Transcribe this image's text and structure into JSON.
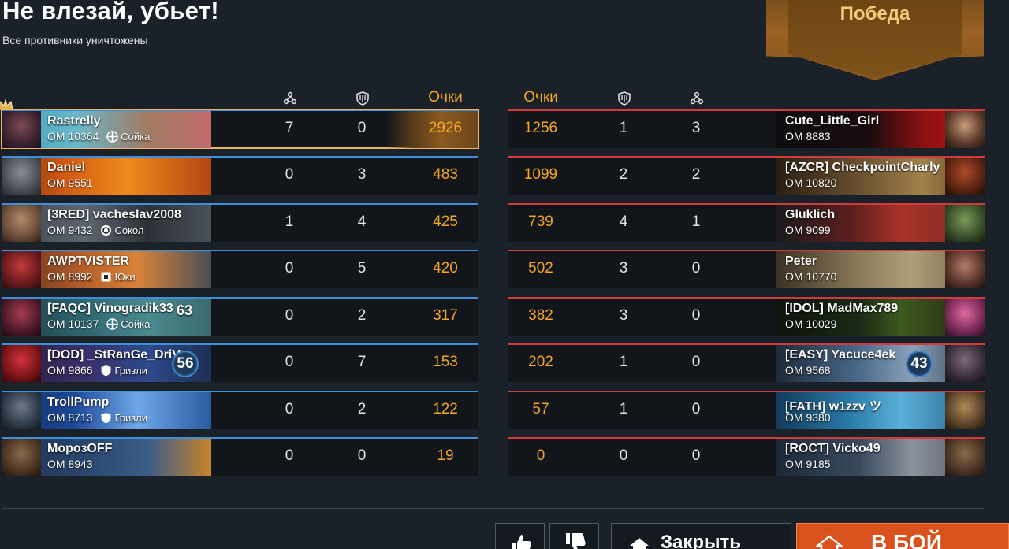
{
  "header": {
    "title": "Не влезай, убьет!",
    "subtitle": "Все противники уничтожены",
    "result": "Победа"
  },
  "columns": {
    "kills_icon": "kills-icon",
    "assists_icon": "shield-icon",
    "points_label_left": "Очки",
    "points_label_right": "Очки"
  },
  "colors": {
    "points": "#f4a623",
    "team_left_accent": "#3e8fd8",
    "team_right_accent": "#d23b3b",
    "mvp_frame": "#e6b56a",
    "battle_button": "#d9521d"
  },
  "team_left": [
    {
      "name": "Rastrelly",
      "rating": "ОМ 10364",
      "rank": "Сойка",
      "rank_icon": "cross-icon",
      "level": "",
      "kills": "7",
      "assists": "0",
      "points": "2926",
      "mvp": true
    },
    {
      "name": "Daniel",
      "rating": "ОМ 9551",
      "rank": "",
      "rank_icon": "",
      "level": "",
      "kills": "0",
      "assists": "3",
      "points": "483"
    },
    {
      "name": "[3RED] vacheslav2008",
      "rating": "ОМ 9432",
      "rank": "Сокол",
      "rank_icon": "cycle-icon",
      "level": "",
      "kills": "1",
      "assists": "4",
      "points": "425"
    },
    {
      "name": "AWPTVISTER",
      "rating": "ОМ 8992",
      "rank": "Юки",
      "rank_icon": "square-icon",
      "level": "",
      "kills": "0",
      "assists": "5",
      "points": "420"
    },
    {
      "name": "[FAQC] Vinogradik33",
      "rating": "ОМ 10137",
      "rank": "Сойка",
      "rank_icon": "cross-icon",
      "level": "63",
      "kills": "0",
      "assists": "2",
      "points": "317"
    },
    {
      "name": "[DOD] _StRanGe_DriV",
      "rating": "ОМ 9866",
      "rank": "Гризли",
      "rank_icon": "shield-small-icon",
      "level": "56",
      "kills": "0",
      "assists": "7",
      "points": "153"
    },
    {
      "name": "TrollPump",
      "rating": "ОМ 8713",
      "rank": "Гризли",
      "rank_icon": "shield-small-icon",
      "level": "",
      "kills": "0",
      "assists": "2",
      "points": "122"
    },
    {
      "name": "МорозOFF",
      "rating": "ОМ 8943",
      "rank": "",
      "rank_icon": "",
      "level": "",
      "kills": "0",
      "assists": "0",
      "points": "19"
    }
  ],
  "team_right": [
    {
      "name": "Cute_Little_Girl",
      "rating": "ОМ 8883",
      "level": "",
      "points": "1256",
      "assists": "1",
      "kills": "3"
    },
    {
      "name": "[AZCR] CheckpointCharly",
      "rating": "ОМ 10820",
      "level": "",
      "points": "1099",
      "assists": "2",
      "kills": "2"
    },
    {
      "name": "Gluklich",
      "rating": "ОМ 9099",
      "level": "",
      "points": "739",
      "assists": "4",
      "kills": "1"
    },
    {
      "name": "Peter",
      "rating": "ОМ 10770",
      "level": "",
      "points": "502",
      "assists": "3",
      "kills": "0"
    },
    {
      "name": "[IDOL] MadMax789",
      "rating": "ОМ 10029",
      "level": "",
      "points": "382",
      "assists": "3",
      "kills": "0"
    },
    {
      "name": "[EASY] Yacuce4ek",
      "rating": "ОМ 9568",
      "level": "43",
      "points": "202",
      "assists": "1",
      "kills": "0"
    },
    {
      "name": "[FATH] w1zzv ツ",
      "rating": "ОМ 9380",
      "level": "",
      "points": "57",
      "assists": "1",
      "kills": "0"
    },
    {
      "name": "[ROCT] Vicko49",
      "rating": "ОМ 9185",
      "level": "",
      "points": "0",
      "assists": "0",
      "kills": "0"
    }
  ],
  "footer": {
    "like_icon": "thumbs-up-icon",
    "dislike_icon": "thumbs-down-icon",
    "close_label": "Закрыть",
    "close_icon": "home-icon",
    "battle_label": "В БОЙ",
    "battle_icon": "home-icon"
  }
}
